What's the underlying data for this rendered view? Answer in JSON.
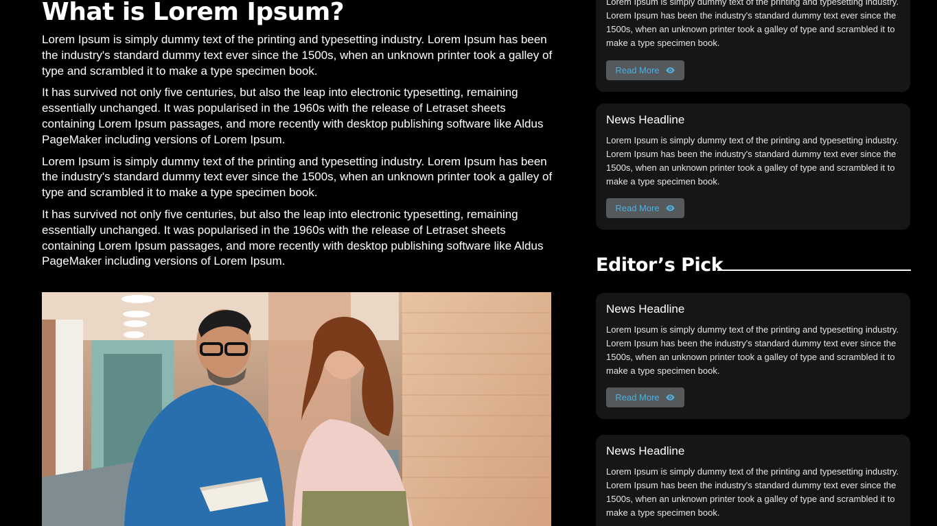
{
  "article": {
    "title": "What is Lorem Ipsum?",
    "paragraphs": [
      "Lorem Ipsum is simply dummy text of the printing and typesetting industry. Lorem Ipsum has been the industry's standard dummy text ever since the 1500s, when an unknown printer took a galley of type and scrambled it to make a type specimen book.",
      "It has survived not only five centuries, but also the leap into electronic typesetting, remaining essentially unchanged. It was popularised in the 1960s with the release of Letraset sheets containing Lorem Ipsum passages, and more recently with desktop publishing software like Aldus PageMaker including versions of Lorem Ipsum.",
      "Lorem Ipsum is simply dummy text of the printing and typesetting industry. Lorem Ipsum has been the industry's standard dummy text ever since the 1500s, when an unknown printer took a galley of type and scrambled it to make a type specimen book.",
      "It has survived not only five centuries, but also the leap into electronic typesetting, remaining essentially unchanged. It was popularised in the 1960s with the release of Letraset sheets containing Lorem Ipsum passages, and more recently with desktop publishing software like Aldus PageMaker including versions of Lorem Ipsum."
    ]
  },
  "news_cards": [
    {
      "headline": "",
      "body": "Lorem Ipsum is simply dummy text of the printing and typesetting industry. Lorem Ipsum has been the industry's standard dummy text ever since the 1500s, when an unknown printer took a galley of type and scrambled it to make a type specimen book.",
      "button": "Read More"
    },
    {
      "headline": "News Headline",
      "body": "Lorem Ipsum is simply dummy text of the printing and typesetting industry. Lorem Ipsum has been the industry's standard dummy text ever since the 1500s, when an unknown printer took a galley of type and scrambled it to make a type specimen book.",
      "button": "Read More"
    }
  ],
  "editors_pick": {
    "title": "Editor’s Pick",
    "cards": [
      {
        "headline": "News Headline",
        "body": "Lorem Ipsum is simply dummy text of the printing and typesetting industry. Lorem Ipsum has been the industry's standard dummy text ever since the 1500s, when an unknown printer took a galley of type and scrambled it to make a type specimen book.",
        "button": "Read More"
      },
      {
        "headline": "News Headline",
        "body": "Lorem Ipsum is simply dummy text of the printing and typesetting industry. Lorem Ipsum has been the industry's standard dummy text ever since the 1500s, when an unknown printer took a galley of type and scrambled it to make a type specimen book."
      }
    ]
  },
  "colors": {
    "background": "#000000",
    "card": "#161616",
    "button_bg": "#55595c",
    "button_text": "#4fb0de"
  },
  "icons": {
    "read_more": "eye-icon"
  }
}
